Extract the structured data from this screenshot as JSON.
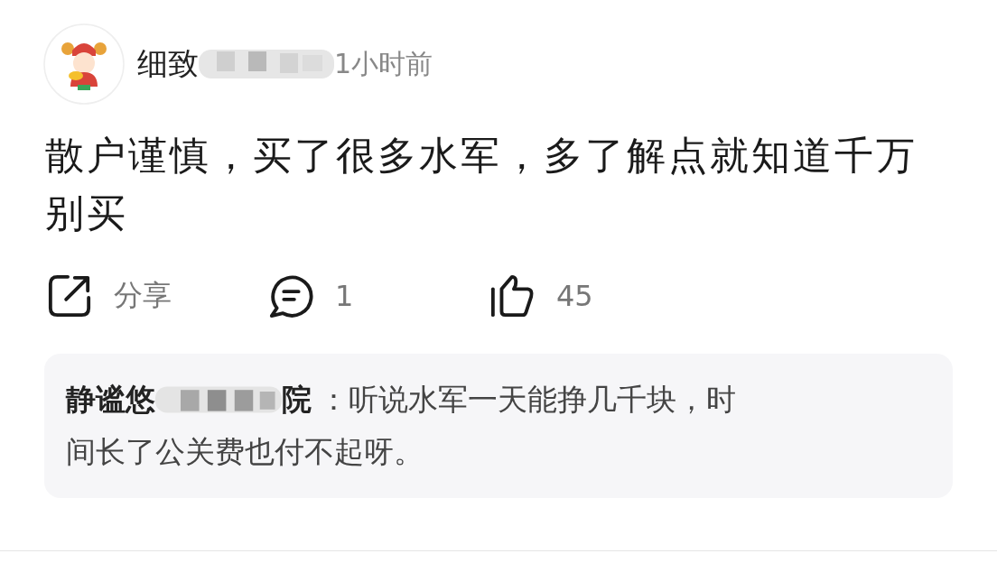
{
  "comment": {
    "author_visible": "细致",
    "time": "1小时前",
    "text": "散户谨慎，买了很多水军，多了解点就知道千万别买"
  },
  "actions": [
    {
      "kind": "share",
      "label": "分享"
    },
    {
      "kind": "reply",
      "label": "1"
    },
    {
      "kind": "like",
      "label": "45"
    }
  ],
  "reply": {
    "author_start": "静谧悠",
    "author_end": "院",
    "text_lines": [
      "：听说水军一天能挣几千块，时",
      "间长了公关费也付不起呀。"
    ]
  }
}
